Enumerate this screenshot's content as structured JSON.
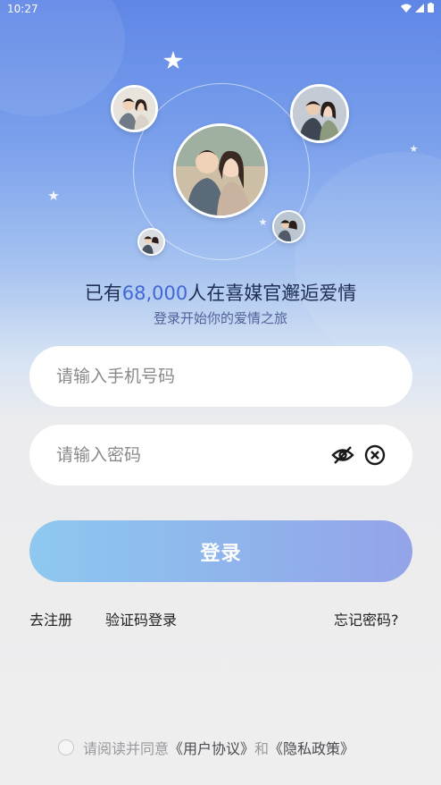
{
  "status_bar": {
    "time": "10:27"
  },
  "hero": {
    "headline_prefix": "已有",
    "headline_number": "68,000",
    "headline_suffix": "人在喜媒官邂逅爱情",
    "subtitle": "登录开始你的爱情之旅"
  },
  "form": {
    "phone_placeholder": "请输入手机号码",
    "password_placeholder": "请输入密码",
    "login_label": "登录"
  },
  "links": {
    "register": "去注册",
    "code_login": "验证码登录",
    "forgot": "忘记密码?"
  },
  "agreement": {
    "prefix": "请阅读并同意",
    "user_agreement": "《用户协议》",
    "conjunction": "和",
    "privacy_policy": "《隐私政策》"
  },
  "colors": {
    "accent": "#3f68d6",
    "button_start": "#8ec8ef",
    "button_end": "#94a3e9"
  }
}
